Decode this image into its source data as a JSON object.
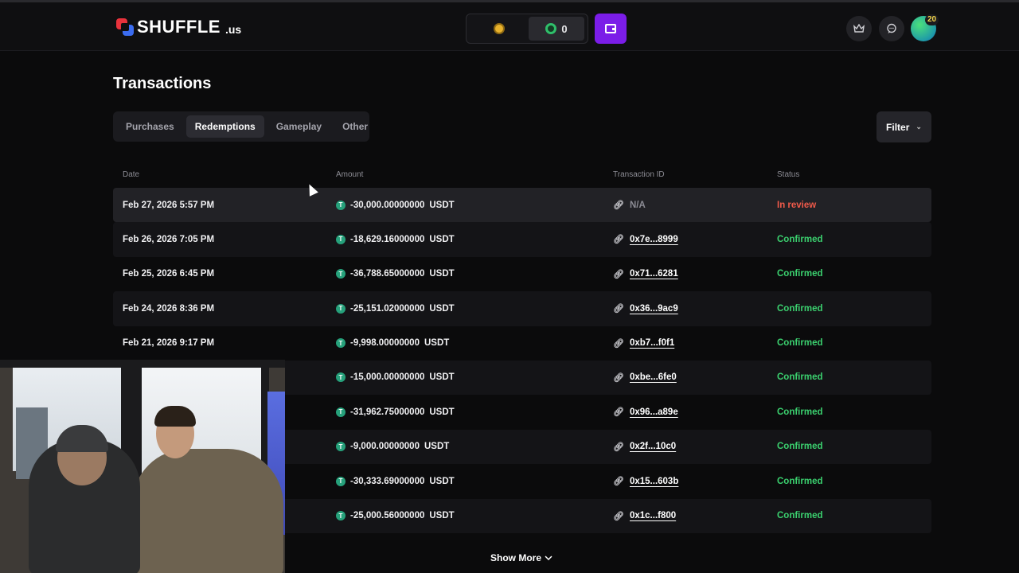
{
  "header": {
    "logo_text": "SHUFFLE",
    "logo_suffix": ".us",
    "sweeps_balance": "0",
    "level_badge": "20"
  },
  "page": {
    "title": "Transactions",
    "tabs": [
      {
        "label": "Purchases",
        "active": false
      },
      {
        "label": "Redemptions",
        "active": true
      },
      {
        "label": "Gameplay",
        "active": false
      },
      {
        "label": "Other",
        "active": false
      }
    ],
    "filter_label": "Filter"
  },
  "table": {
    "columns": {
      "date": "Date",
      "amount": "Amount",
      "transaction_id": "Transaction ID",
      "status": "Status"
    },
    "rows": [
      {
        "date": "Feb 27, 2026 5:57 PM",
        "amount": "-30,000.00000000",
        "currency": "USDT",
        "tx": "N/A",
        "status": "In review"
      },
      {
        "date": "Feb 26, 2026 7:05 PM",
        "amount": "-18,629.16000000",
        "currency": "USDT",
        "tx": "0x7e...8999",
        "status": "Confirmed"
      },
      {
        "date": "Feb 25, 2026 6:45 PM",
        "amount": "-36,788.65000000",
        "currency": "USDT",
        "tx": "0x71...6281",
        "status": "Confirmed"
      },
      {
        "date": "Feb 24, 2026 8:36 PM",
        "amount": "-25,151.02000000",
        "currency": "USDT",
        "tx": "0x36...9ac9",
        "status": "Confirmed"
      },
      {
        "date": "Feb 21, 2026 9:17 PM",
        "amount": "-9,998.00000000",
        "currency": "USDT",
        "tx": "0xb7...f0f1",
        "status": "Confirmed"
      },
      {
        "date": "",
        "amount": "-15,000.00000000",
        "currency": "USDT",
        "tx": "0xbe...6fe0",
        "status": "Confirmed"
      },
      {
        "date": "",
        "amount": "-31,962.75000000",
        "currency": "USDT",
        "tx": "0x96...a89e",
        "status": "Confirmed"
      },
      {
        "date": "",
        "amount": "-9,000.00000000",
        "currency": "USDT",
        "tx": "0x2f...10c0",
        "status": "Confirmed"
      },
      {
        "date": "",
        "amount": "-30,333.69000000",
        "currency": "USDT",
        "tx": "0x15...603b",
        "status": "Confirmed"
      },
      {
        "date": "",
        "amount": "-25,000.56000000",
        "currency": "USDT",
        "tx": "0x1c...f800",
        "status": "Confirmed"
      }
    ]
  },
  "show_more_label": "Show More",
  "colors": {
    "accent_purple": "#7b1de8",
    "confirmed_green": "#3bd16f",
    "review_red": "#f05a4a",
    "tether_green": "#26a17b"
  },
  "icons": {
    "wallet": "wallet-icon",
    "crown": "crown-icon",
    "chat": "chat-icon",
    "link": "link-icon",
    "tether": "tether-icon"
  }
}
